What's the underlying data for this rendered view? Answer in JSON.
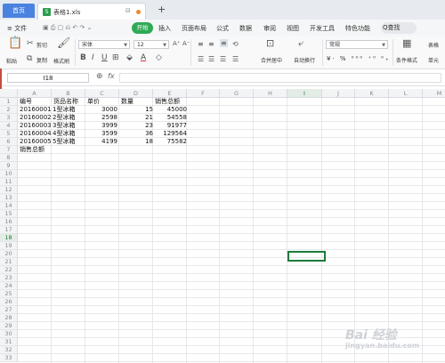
{
  "tabs": {
    "home": "首页",
    "document": "表格1.xls",
    "add": "+"
  },
  "menu": {
    "file": "≡ 文件",
    "start": "开始",
    "items": [
      "插入",
      "页面布局",
      "公式",
      "数据",
      "审阅",
      "视图",
      "开发工具",
      "特色功能"
    ],
    "search": "Q查找"
  },
  "ribbon": {
    "paste": "粘贴",
    "cut": "剪切",
    "copy": "复制",
    "format_painter": "格式刷",
    "font_name": "宋体",
    "font_size": "12",
    "merge_center": "合并居中",
    "wrap_text": "自动换行",
    "number_format": "常规",
    "conditional_format": "条件格式",
    "table_style": "表格",
    "single_cell": "单元"
  },
  "formula_bar": {
    "name_box": "I18",
    "fx": "fx"
  },
  "columns": [
    "A",
    "B",
    "C",
    "D",
    "E",
    "F",
    "G",
    "H",
    "I",
    "J",
    "K",
    "L",
    "M"
  ],
  "rows": [
    "1",
    "2",
    "3",
    "4",
    "5",
    "6",
    "7",
    "8",
    "9",
    "10",
    "11",
    "12",
    "13",
    "14",
    "15",
    "16",
    "17",
    "18",
    "19",
    "20",
    "21",
    "22",
    "23",
    "24",
    "25",
    "26",
    "27",
    "28",
    "29",
    "30",
    "31",
    "32",
    "33"
  ],
  "table": {
    "headers": [
      "编号",
      "货品名称",
      "单价",
      "数量",
      "销售总额"
    ],
    "data": [
      [
        "20160001",
        "1型冰箱",
        "3000",
        "15",
        "45000"
      ],
      [
        "20160002",
        "2型冰箱",
        "2598",
        "21",
        "54558"
      ],
      [
        "20160003",
        "3型冰箱",
        "3999",
        "23",
        "91977"
      ],
      [
        "20160004",
        "4型冰箱",
        "3599",
        "36",
        "129564"
      ],
      [
        "20160005",
        "5型冰箱",
        "4199",
        "18",
        "75582"
      ]
    ],
    "footer": "销售总额"
  },
  "watermark": {
    "main": "Bai 经验",
    "sub": "jingyan.baidu.com"
  },
  "colors": {
    "accent": "#2eaa55",
    "home_tab": "#4a82e0",
    "selection": "#1f7a3d"
  }
}
